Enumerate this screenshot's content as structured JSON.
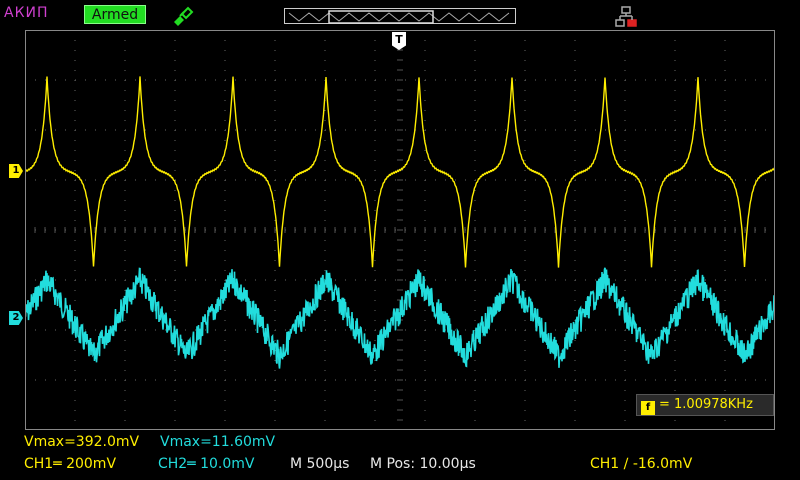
{
  "topbar": {
    "brand": "АКИП",
    "status": "Armed",
    "trigger_marker": "T",
    "icons": [
      "probe-icon",
      "buffer-bar",
      "network-disconnected-icon"
    ]
  },
  "channels": {
    "ch1_marker": "1",
    "ch2_marker": "2",
    "ch1_color": "#ffee00",
    "ch2_color": "#22dddd"
  },
  "measurements": {
    "frequency_badge": "f",
    "frequency": "= 1.00978KHz",
    "ch1_vmax": "Vmax=392.0mV",
    "ch2_vmax": "Vmax=11.60mV"
  },
  "settings": {
    "ch1_scale": "CH1═ 200mV",
    "ch2_scale": "CH2═ 10.0mV",
    "timebase": "M 500µs",
    "mpos": "M Pos: 10.00µs",
    "trigger": "CH1 ∕ -16.0mV"
  }
}
